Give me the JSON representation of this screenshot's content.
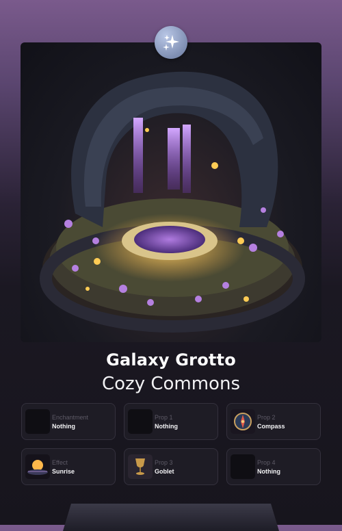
{
  "item": {
    "name": "Galaxy Grotto",
    "collection": "Cozy Commons"
  },
  "slots": [
    {
      "label": "Enchantment",
      "value": "Nothing",
      "icon": "empty-slot-icon"
    },
    {
      "label": "Prop 1",
      "value": "Nothing",
      "icon": "empty-slot-icon"
    },
    {
      "label": "Prop 2",
      "value": "Compass",
      "icon": "compass-icon"
    },
    {
      "label": "Effect",
      "value": "Sunrise",
      "icon": "sunrise-icon"
    },
    {
      "label": "Prop 3",
      "value": "Goblet",
      "icon": "goblet-icon"
    },
    {
      "label": "Prop 4",
      "value": "Nothing",
      "icon": "empty-slot-icon"
    }
  ],
  "colors": {
    "accent_purple": "#9b59d6",
    "glow_gold": "#ffcc55",
    "panel_bg": "#1e1c25"
  }
}
